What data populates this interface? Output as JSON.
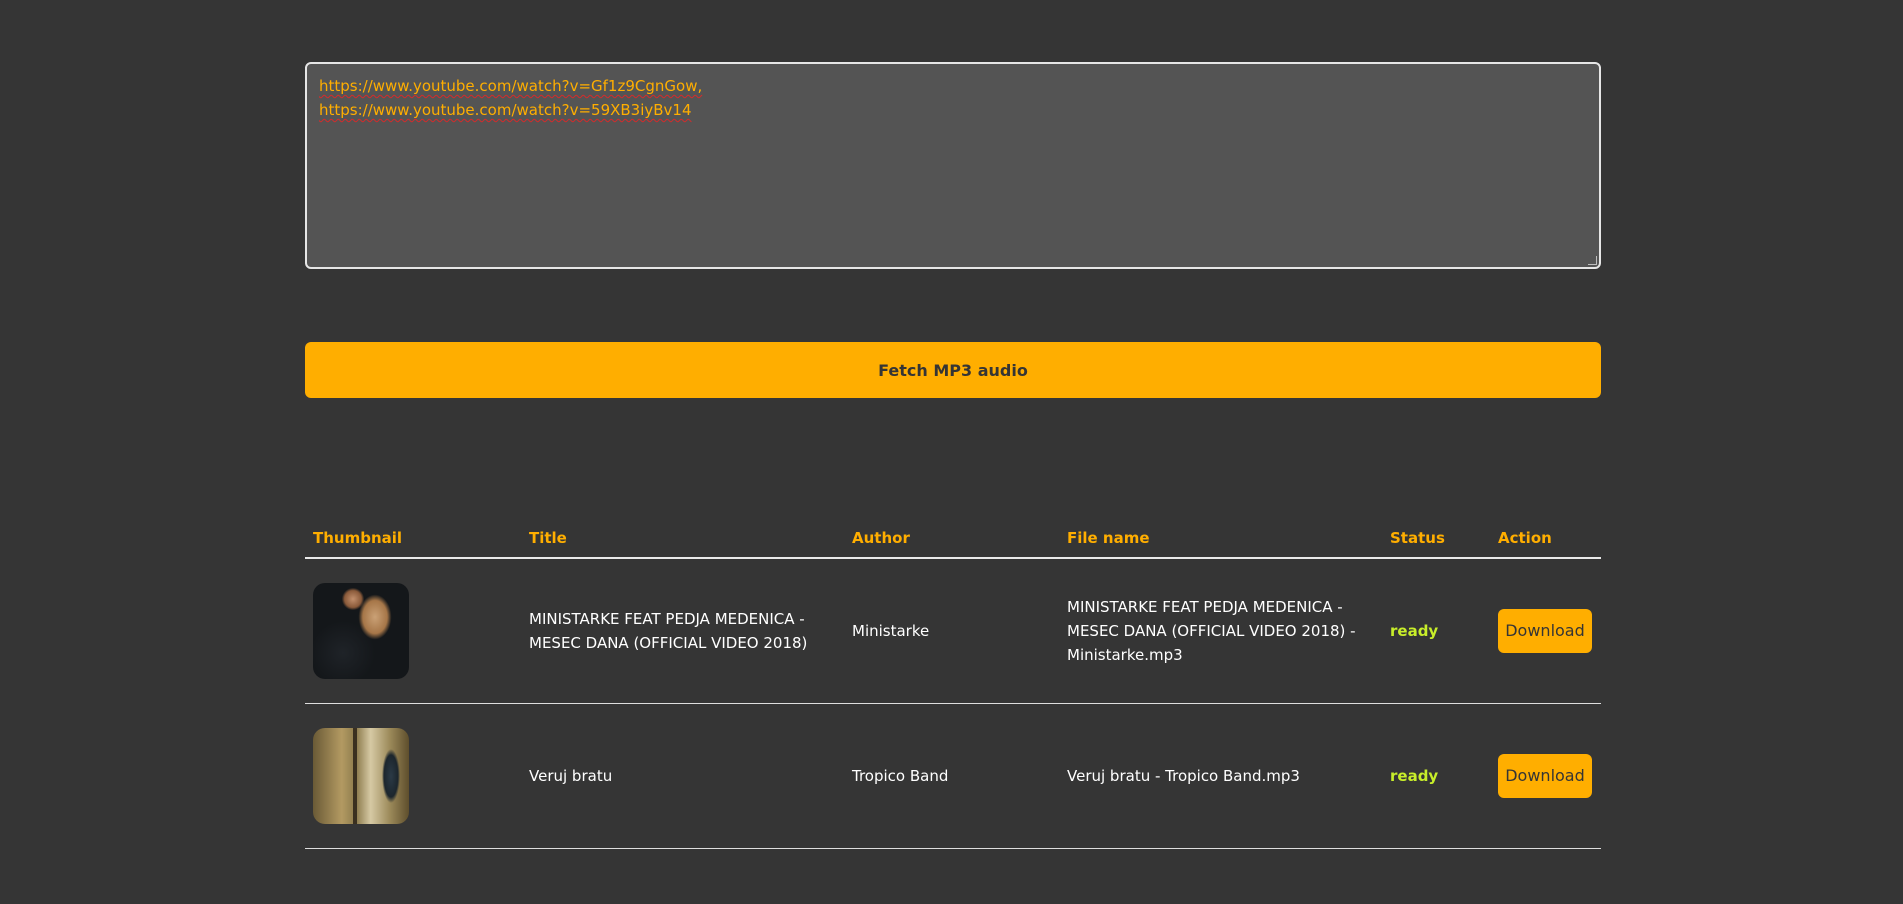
{
  "url_input": {
    "lines": [
      "https://www.youtube.com/watch?v=Gf1z9CgnGow,",
      "https://www.youtube.com/watch?v=59XB3iyBv14"
    ]
  },
  "fetch_button": {
    "label": "Fetch MP3 audio"
  },
  "table": {
    "headers": [
      "Thumbnail",
      "Title",
      "Author",
      "File name",
      "Status",
      "Action"
    ],
    "rows": [
      {
        "title": "MINISTARKE FEAT PEDJA MEDENICA - MESEC DANA (OFFICIAL VIDEO 2018)",
        "author": "Ministarke",
        "file_name": "MINISTARKE FEAT PEDJA MEDENICA - MESEC DANA (OFFICIAL VIDEO 2018) - Ministarke.mp3",
        "status": "ready",
        "action": "Download"
      },
      {
        "title": "Veruj bratu",
        "author": "Tropico Band",
        "file_name": "Veruj bratu - Tropico Band.mp3",
        "status": "ready",
        "action": "Download"
      }
    ]
  },
  "colors": {
    "background": "#353535",
    "accent": "#ffae00",
    "status_ready": "#c8ee2a"
  }
}
